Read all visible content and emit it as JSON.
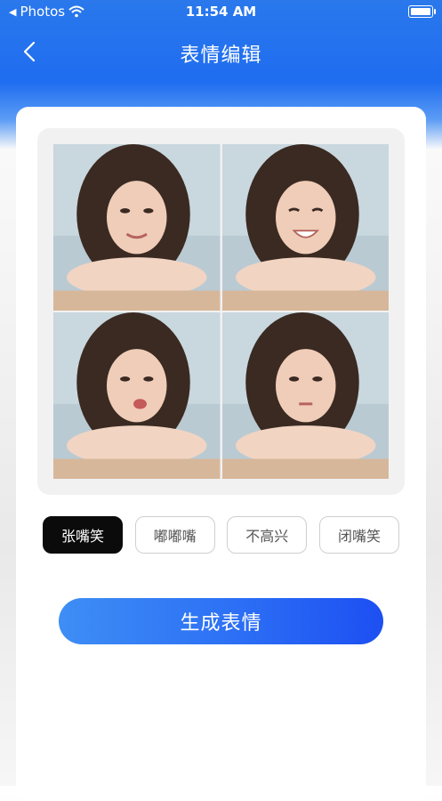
{
  "status_bar": {
    "back_app": "Photos",
    "time": "11:54 AM"
  },
  "header": {
    "title": "表情编辑"
  },
  "preview": {
    "photos": [
      {
        "expression": "smile"
      },
      {
        "expression": "grin"
      },
      {
        "expression": "pout"
      },
      {
        "expression": "neutral"
      }
    ]
  },
  "options": [
    {
      "label": "张嘴笑",
      "selected": true
    },
    {
      "label": "嘟嘟嘴",
      "selected": false
    },
    {
      "label": "不高兴",
      "selected": false
    },
    {
      "label": "闭嘴笑",
      "selected": false
    }
  ],
  "generate_button": "生成表情",
  "colors": {
    "accent": "#1f6df0",
    "selected_option": "#0b0b0b"
  }
}
